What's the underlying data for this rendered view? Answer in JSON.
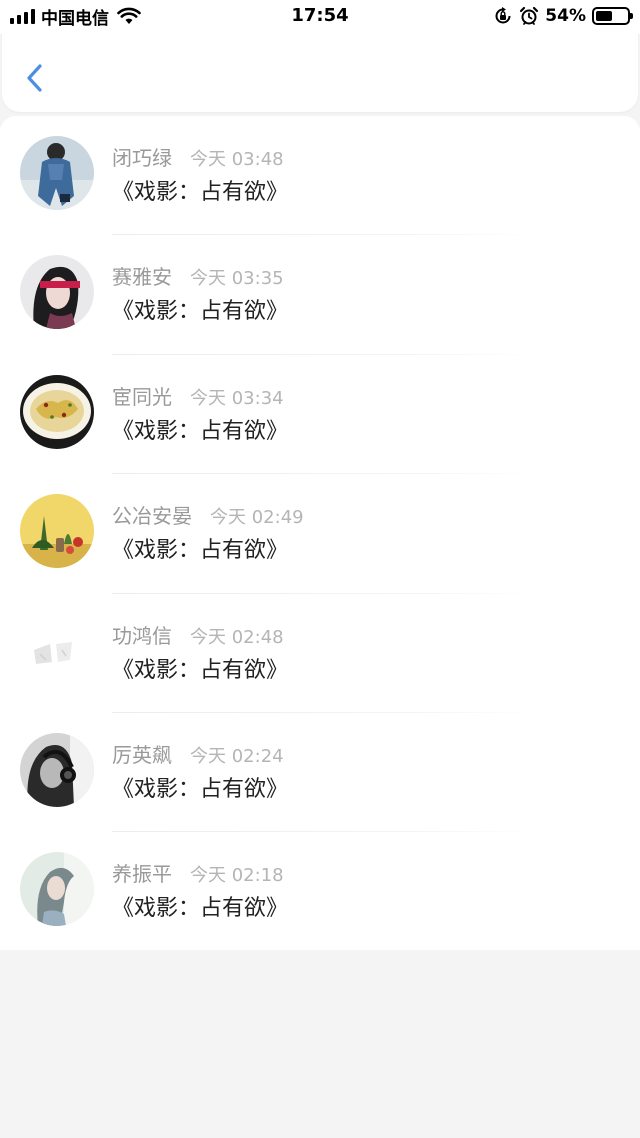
{
  "status_bar": {
    "carrier": "中国电信",
    "time": "17:54",
    "battery_percent": "54%",
    "battery_level": 0.54,
    "icons": [
      "signal-icon",
      "wifi-icon",
      "orientation-lock-icon",
      "alarm-icon",
      "battery-icon"
    ]
  },
  "nav": {
    "back_icon": "chevron-left-icon",
    "accent": "#4a90e2"
  },
  "items": [
    {
      "name": "闭巧绿",
      "time": "今天 03:48",
      "text": "《戏影：占有欲》",
      "avatar": "person-denim-avatar"
    },
    {
      "name": "赛雅安",
      "time": "今天 03:35",
      "text": "《戏影：占有欲》",
      "avatar": "blindfold-girl-avatar"
    },
    {
      "name": "宦同光",
      "time": "今天 03:34",
      "text": "《戏影：占有欲》",
      "avatar": "food-plate-avatar"
    },
    {
      "name": "公冶安晏",
      "time": "今天 02:49",
      "text": "《戏影：占有欲》",
      "avatar": "succulent-plants-avatar"
    },
    {
      "name": "功鸿信",
      "time": "今天 02:48",
      "text": "《戏影：占有欲》",
      "avatar": "faint-sketch-avatar"
    },
    {
      "name": "厉英飙",
      "time": "今天 02:24",
      "text": "《戏影：占有欲》",
      "avatar": "headphones-girl-avatar"
    },
    {
      "name": "养振平",
      "time": "今天 02:18",
      "text": "《戏影：占有欲》",
      "avatar": "soft-portrait-avatar"
    }
  ]
}
